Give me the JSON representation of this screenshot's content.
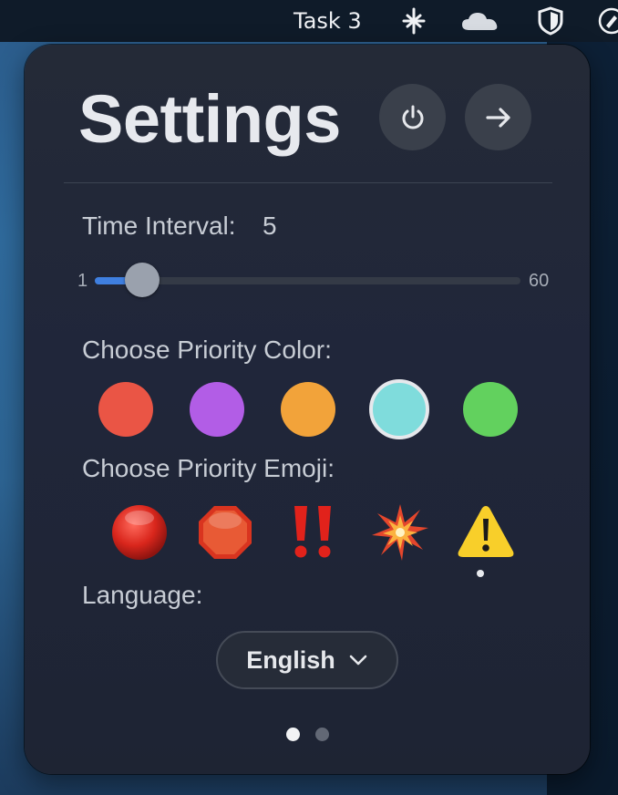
{
  "menubar": {
    "task_label": "Task 3"
  },
  "panel": {
    "title": "Settings"
  },
  "interval": {
    "label": "Time Interval:",
    "value": "5",
    "min_label": "1",
    "max_label": "60",
    "min": 1,
    "max": 60,
    "current": 5
  },
  "priority_color": {
    "label": "Choose Priority Color:",
    "options": [
      "#ea5545",
      "#b25de6",
      "#f2a33a",
      "#7fdcdc",
      "#62d15e"
    ],
    "selected_index": 3
  },
  "priority_emoji": {
    "label": "Choose Priority Emoji:",
    "options": [
      "red-circle-icon",
      "stop-sign-icon",
      "double-exclamation-icon",
      "collision-icon",
      "warning-icon"
    ],
    "selected_index": 4
  },
  "language": {
    "label": "Language:",
    "selected": "English"
  },
  "pagination": {
    "total": 2,
    "current": 1
  },
  "colors": {
    "accent": "#3f7fe0",
    "panel_bg": "#232937"
  }
}
